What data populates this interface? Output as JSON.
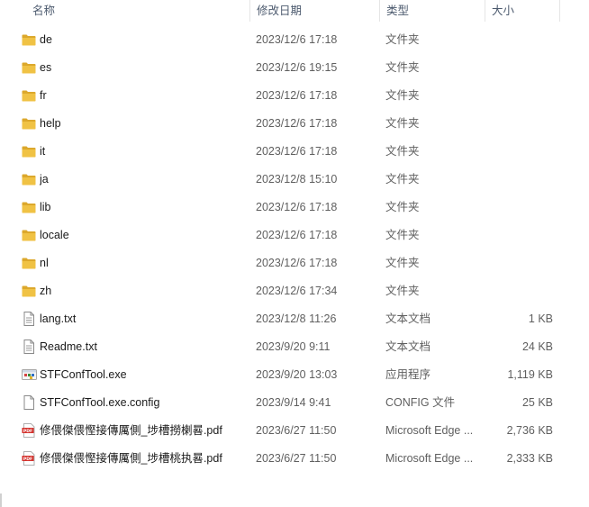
{
  "columns": {
    "name": "名称",
    "date": "修改日期",
    "type": "类型",
    "size": "大小"
  },
  "icons": {
    "folder": "folder-icon",
    "text": "text-file-icon",
    "exe": "exe-icon",
    "config": "config-file-icon",
    "pdf": "pdf-icon"
  },
  "colors": {
    "folder": "#f0c244",
    "folder_dark": "#dca82c",
    "pdf": "#d4322d"
  },
  "files": [
    {
      "name": "de",
      "date": "2023/12/6 17:18",
      "type": "文件夹",
      "size": "",
      "icon": "folder"
    },
    {
      "name": "es",
      "date": "2023/12/6 19:15",
      "type": "文件夹",
      "size": "",
      "icon": "folder"
    },
    {
      "name": "fr",
      "date": "2023/12/6 17:18",
      "type": "文件夹",
      "size": "",
      "icon": "folder"
    },
    {
      "name": "help",
      "date": "2023/12/6 17:18",
      "type": "文件夹",
      "size": "",
      "icon": "folder"
    },
    {
      "name": "it",
      "date": "2023/12/6 17:18",
      "type": "文件夹",
      "size": "",
      "icon": "folder"
    },
    {
      "name": "ja",
      "date": "2023/12/8 15:10",
      "type": "文件夹",
      "size": "",
      "icon": "folder"
    },
    {
      "name": "lib",
      "date": "2023/12/6 17:18",
      "type": "文件夹",
      "size": "",
      "icon": "folder"
    },
    {
      "name": "locale",
      "date": "2023/12/6 17:18",
      "type": "文件夹",
      "size": "",
      "icon": "folder"
    },
    {
      "name": "nl",
      "date": "2023/12/6 17:18",
      "type": "文件夹",
      "size": "",
      "icon": "folder"
    },
    {
      "name": "zh",
      "date": "2023/12/6 17:34",
      "type": "文件夹",
      "size": "",
      "icon": "folder"
    },
    {
      "name": "lang.txt",
      "date": "2023/12/8 11:26",
      "type": "文本文档",
      "size": "1 KB",
      "icon": "text"
    },
    {
      "name": "Readme.txt",
      "date": "2023/9/20 9:11",
      "type": "文本文档",
      "size": "24 KB",
      "icon": "text"
    },
    {
      "name": "STFConfTool.exe",
      "date": "2023/9/20 13:03",
      "type": "应用程序",
      "size": "1,119 KB",
      "icon": "exe"
    },
    {
      "name": "STFConfTool.exe.config",
      "date": "2023/9/14 9:41",
      "type": "CONFIG 文件",
      "size": "25 KB",
      "icon": "config"
    },
    {
      "name": "修偎傑偎慳接傳厲側_埗槽撈楋晷.pdf",
      "date": "2023/6/27 11:50",
      "type": "Microsoft Edge ...",
      "size": "2,736 KB",
      "icon": "pdf"
    },
    {
      "name": "修偎傑偎慳接傳厲側_埗槽桃执晷.pdf",
      "date": "2023/6/27 11:50",
      "type": "Microsoft Edge ...",
      "size": "2,333 KB",
      "icon": "pdf"
    }
  ]
}
